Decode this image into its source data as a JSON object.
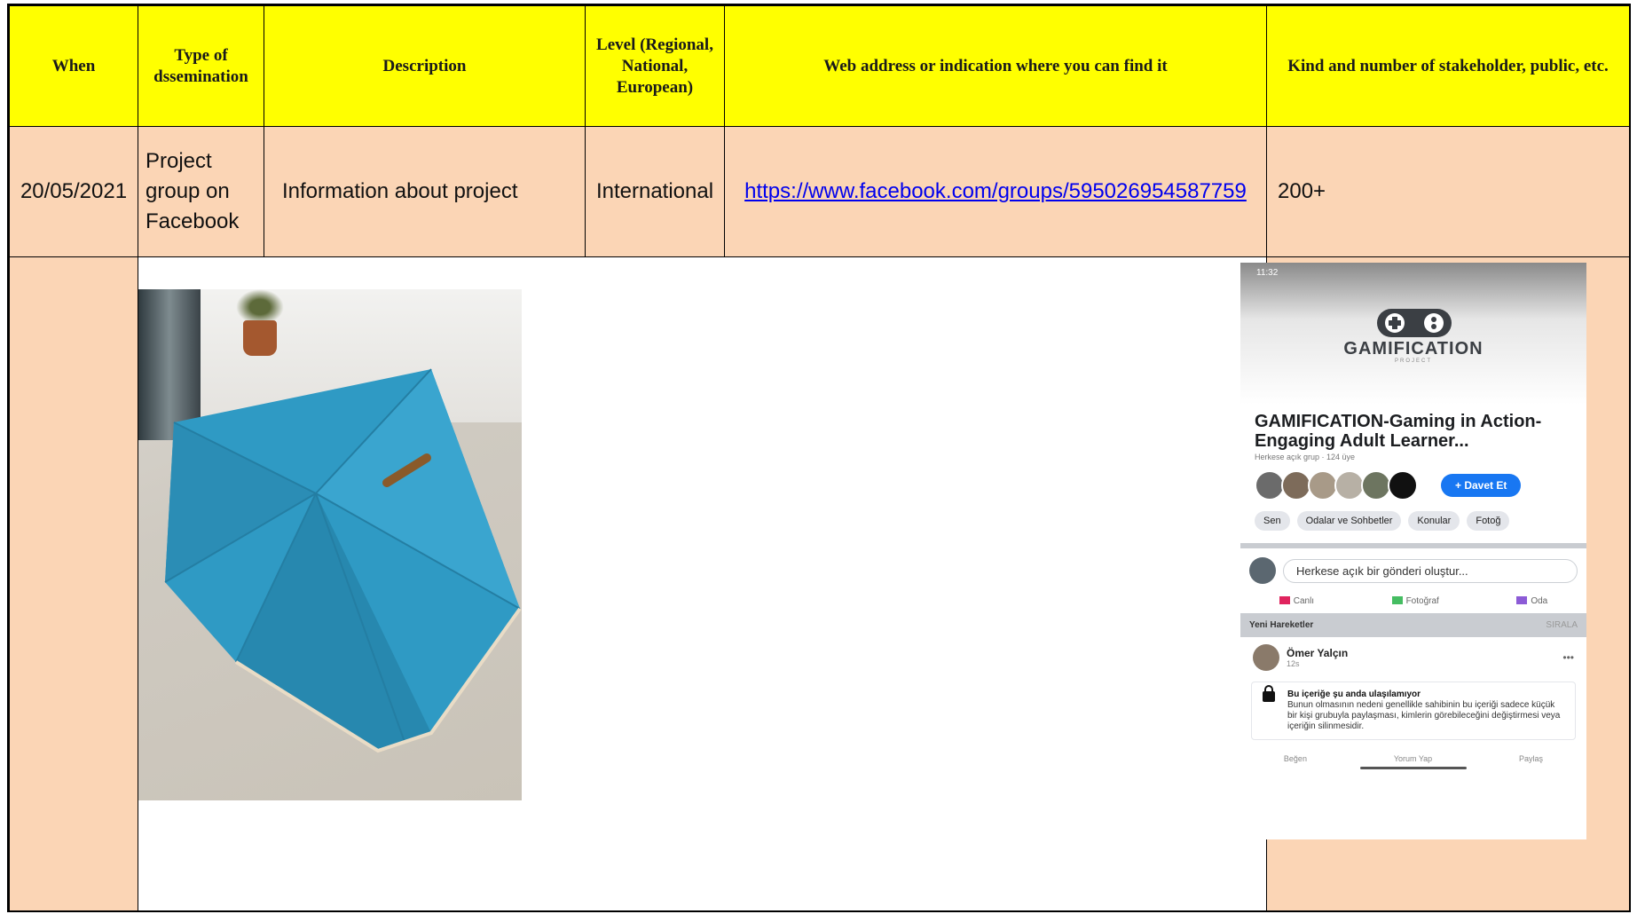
{
  "headers": {
    "when": "When",
    "type": "Type of dssemination",
    "description": "Description",
    "level": "Level (Regional, National, European)",
    "web": "Web address or indication where you can find it",
    "kind": "Kind and number of stakeholder, public, etc."
  },
  "row": {
    "when": "20/05/2021",
    "type": "Project group on Facebook",
    "description": "Information about project",
    "level": "International",
    "web": "https://www.facebook.com/groups/595026954587759",
    "kind": "200+"
  },
  "colors": {
    "header_bg": "#ffff00",
    "row_bg": "#fbd5b5",
    "link": "#0000ee",
    "fb_blue": "#1877f2",
    "umbrella": "#2f9ac4"
  },
  "phone": {
    "status_time": "11:32",
    "brand": "GAMIFICATION",
    "brand_sub": "PROJECT",
    "group_title": "GAMIFICATION-Gaming in Action-Engaging Adult Learner...",
    "meta": "Herkese açık grup · 124 üye",
    "invite": "+ Davet Et",
    "chips": [
      "Sen",
      "Odalar ve Sohbetler",
      "Konular",
      "Fotoğ"
    ],
    "composer_placeholder": "Herkese açık bir gönderi oluştur...",
    "actions": [
      "Canlı",
      "Fotoğraf",
      "Oda"
    ],
    "new_activity": "Yeni Hareketler",
    "sort": "SIRALA",
    "post_author": "Ömer Yalçın",
    "post_time": "12s",
    "notice_title": "Bu içeriğe şu anda ulaşılamıyor",
    "notice_body": "Bunun olmasının nedeni genellikle sahibinin bu içeriği sadece küçük bir kişi grubuyla paylaşması, kimlerin görebileceğini değiştirmesi veya içeriğin silinmesidir.",
    "reacts": [
      "Beğen",
      "Yorum Yap",
      "Paylaş"
    ]
  }
}
